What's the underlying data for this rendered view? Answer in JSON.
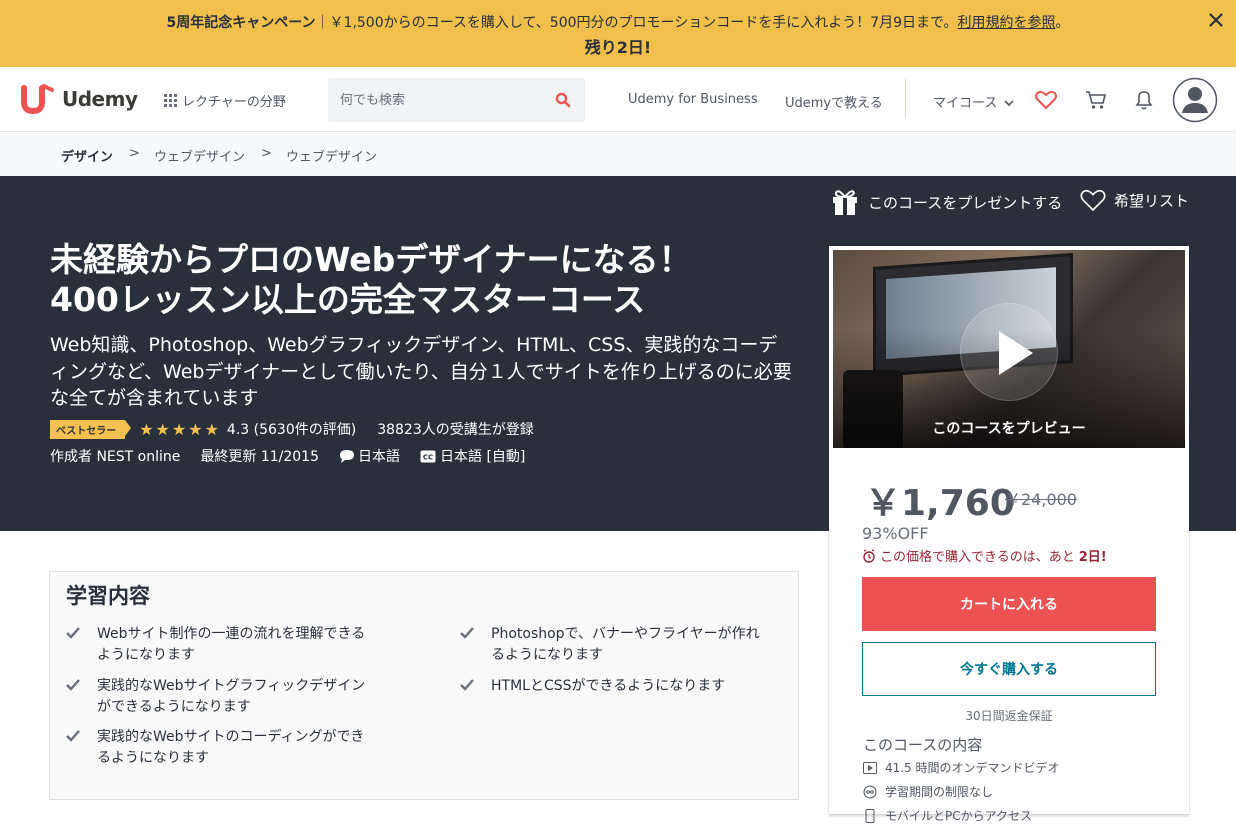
{
  "promo": {
    "campaign": "5周年記念キャンペーン",
    "message": "｜￥1,500からのコースを購入して、500円分のプロモーションコードを手に入れよう！7月9日まで。",
    "terms_link": "利用規約を参照",
    "period": "。",
    "countdown": "残り2日!"
  },
  "header": {
    "logo": "Udemy",
    "categories": "レクチャーの分野",
    "search_placeholder": "何でも検索",
    "business": "Udemy for Business",
    "teach": "Udemyで教える",
    "my_courses": "マイコース"
  },
  "breadcrumb": [
    "デザイン",
    "ウェブデザイン",
    "ウェブデザイン"
  ],
  "breadcrumb_sep": ">",
  "course": {
    "title_line1": "未経験からプロのWebデザイナーになる！",
    "title_line2": "400レッスン以上の完全マスターコース",
    "subtitle": "Web知識、Photoshop、Webグラフィックデザイン、HTML、CSS、実践的なコーディングなど、Webデザイナーとして働いたり、自分１人でサイトを作り上げるのに必要な全てが含まれています",
    "badge": "ベストセラー",
    "stars": "★★★★★",
    "rating": "4.3 (5630件の評価)",
    "students": "38823人の受講生が登録",
    "author": "作成者 NEST online",
    "updated": "最終更新 11/2015",
    "language": "日本語",
    "captions": "日本語 [自動]",
    "gift": "このコースをプレゼントする",
    "wishlist": "希望リスト"
  },
  "sidebar": {
    "preview_label": "このコースをプレビュー",
    "price": "￥1,760",
    "original_price": "￥24,000",
    "discount": "93%OFF",
    "urgency_prefix": "この価格で購入できるのは、あと",
    "urgency_days": "2日!",
    "add_to_cart": "カートに入れる",
    "buy_now": "今すぐ購入する",
    "guarantee": "30日間返金保証",
    "includes_heading": "このコースの内容",
    "includes": [
      "41.5 時間のオンデマンドビデオ",
      "学習期間の制限なし",
      "モバイルとPCからアクセス"
    ]
  },
  "learn": {
    "heading": "学習内容",
    "items": [
      "Webサイト制作の一連の流れを理解できるようになります",
      "Photoshopで、バナーやフライヤーが作れるようになります",
      "実践的なWebサイトグラフィックデザインができるようになります",
      "HTMLとCSSができるようになります",
      "実践的なWebサイトのコーディングができるようになります"
    ]
  },
  "colors": {
    "promo_bg": "#f0bf4c",
    "hero_bg": "#29303b",
    "cart_button": "#ec5252",
    "buy_button": "#007791",
    "brand_red": "#ec5252",
    "urgency": "#992337"
  }
}
